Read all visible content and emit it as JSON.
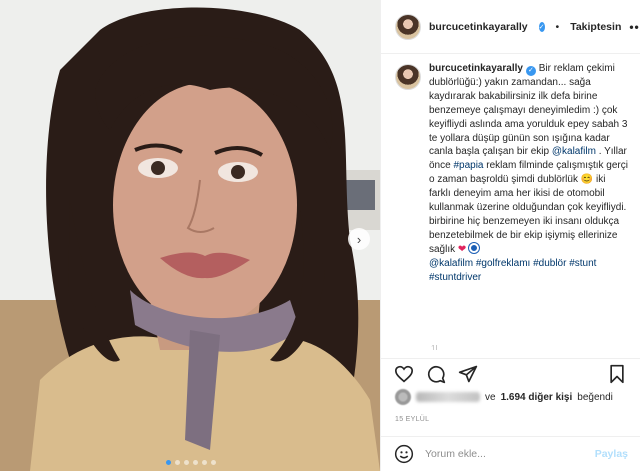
{
  "post": {
    "photo_alt": "",
    "dots": [
      true,
      false,
      false,
      false,
      false,
      false
    ]
  },
  "header": {
    "username": "burcucetinkayarally",
    "separator": "•",
    "follow_label": "Takiptesin",
    "more_label": "•••"
  },
  "caption": {
    "username": "burcucetinkayarally",
    "text_parts": [
      {
        "t": " Bir reklam çekimi dublörlüğü:) yakın zamandan... sağa kaydırarak bakabilirsiniz ilk defa birine benzemeye çalışmayı deneyimledim :) çok keyifliydi aslında ama yorulduk epey sabah 3 te yollara düşüp günün son ışığına kadar canla başla çalışan bir ekip ",
        "tag": false
      },
      {
        "t": "@kalafilm",
        "tag": true
      },
      {
        "t": " . Yıllar önce ",
        "tag": false
      },
      {
        "t": "#papia",
        "tag": true
      },
      {
        "t": " reklam filminde çalışmıştık gerçi o zaman başroldü şimdi dublörlük ",
        "tag": false
      },
      {
        "t": "😊",
        "tag": false
      },
      {
        "t": " iki farklı deneyim ama her ikisi de otomobil kullanmak üzerine olduğundan çok keyifliydi. birbirine hiç benzemeyen iki insanı oldukça benzetebilmek de bir ekip işiymiş ellerinize sağlık ",
        "tag": false
      },
      {
        "t": "❤",
        "tag": false
      }
    ],
    "hashtags": [
      "@kalafilm",
      "#golfreklamı",
      "#dublör",
      "#stunt",
      "#stuntdriver"
    ],
    "fade_line": "1L"
  },
  "likes": {
    "prefix": "ve",
    "count_text": "1.694 diğer kişi",
    "suffix": "beğendi"
  },
  "date": "15 EYLÜL",
  "comment_box": {
    "placeholder": "Yorum ekle...",
    "post_label": "Paylaş"
  },
  "icons": {
    "like": "heart-outline-icon",
    "comment": "comment-bubble-icon",
    "share": "paper-plane-icon",
    "save": "bookmark-icon",
    "emoji": "smiley-icon",
    "next": "chevron-right-icon"
  },
  "colors": {
    "accent": "#3897f0",
    "link": "#00376b",
    "muted": "#8e8e8e"
  }
}
